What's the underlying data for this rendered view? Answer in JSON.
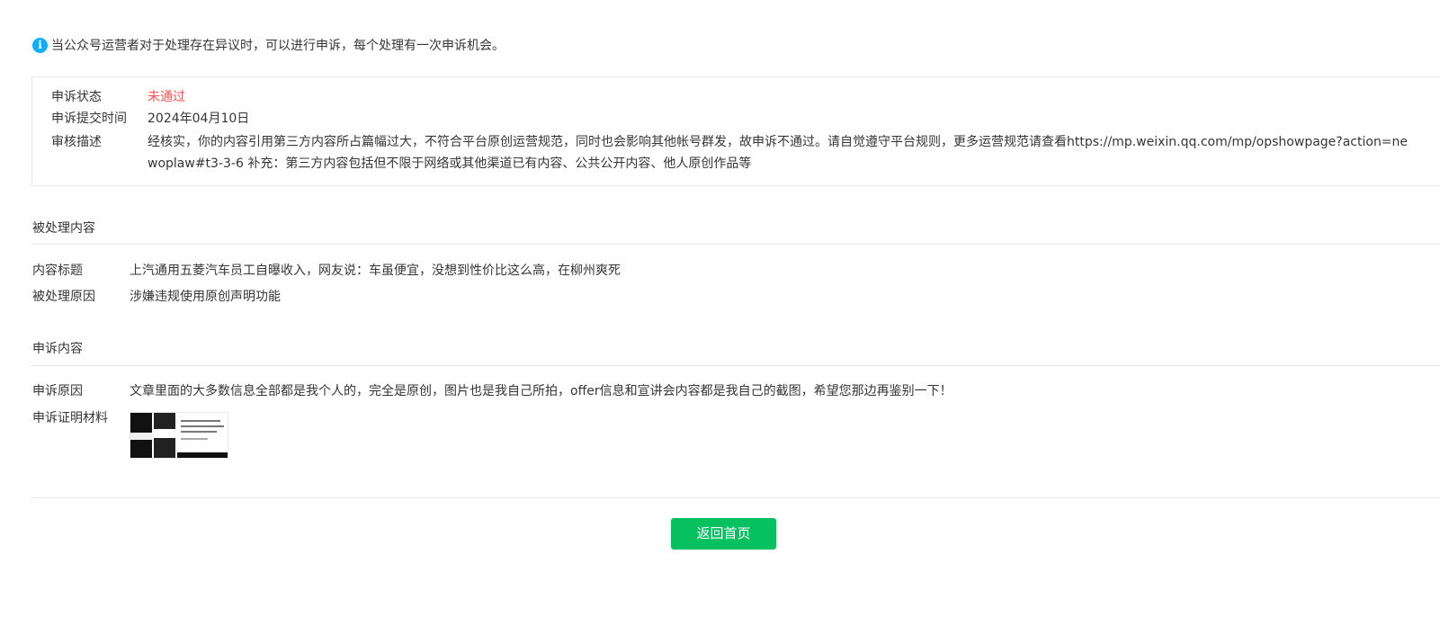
{
  "notice": {
    "icon": "info-icon",
    "text": "当公众号运营者对于处理存在异议时，可以进行申诉，每个处理有一次申诉机会。"
  },
  "appeal_status": {
    "status_label": "申诉状态",
    "status_value": "未通过",
    "status_color": "#fa5151",
    "submit_time_label": "申诉提交时间",
    "submit_time_value": "2024年04月10日",
    "review_label": "审核描述",
    "review_value": "经核实，你的内容引用第三方内容所占篇幅过大，不符合平台原创运营规范，同时也会影响其他帐号群发，故申诉不通过。请自觉遵守平台规则，更多运营规范请查看https://mp.weixin.qq.com/mp/opshowpage?action=newoplaw#t3-3-6 补充：第三方内容包括但不限于网络或其他渠道已有内容、公共公开内容、他人原创作品等"
  },
  "processed_content": {
    "section_title": "被处理内容",
    "title_label": "内容标题",
    "title_value": "上汽通用五菱汽车员工自曝收入，网友说：车虽便宜，没想到性价比这么高，在柳州爽死",
    "reason_label": "被处理原因",
    "reason_value": "涉嫌违规使用原创声明功能"
  },
  "appeal_content": {
    "section_title": "申诉内容",
    "reason_label": "申诉原因",
    "reason_value": "文章里面的大多数信息全部都是我个人的，完全是原创，图片也是我自己所拍，offer信息和宣讲会内容都是我自己的截图，希望您那边再鉴别一下！",
    "evidence_label": "申诉证明材料"
  },
  "actions": {
    "back_home_label": "返回首页",
    "button_color": "#07c160"
  }
}
